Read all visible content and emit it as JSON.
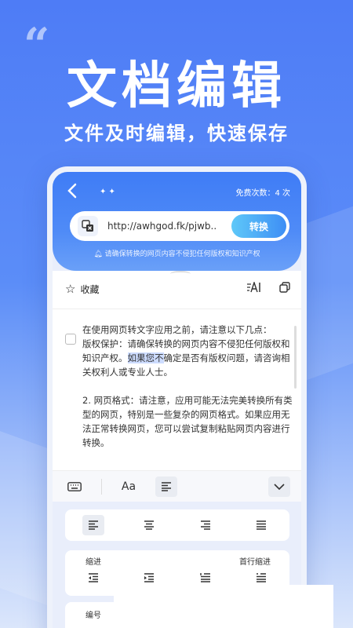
{
  "hero": {
    "quote": "“",
    "title": "文档编辑",
    "subtitle": "文件及时编辑，快速保存"
  },
  "app": {
    "free_count": "免费次数：4 次",
    "url_value": "http://awhgod.fk/pjwb..",
    "convert_label": "转换",
    "notice": "请确保转换的网页内容不侵犯任何版权和知识产权",
    "favorite_label": "收藏",
    "doc": {
      "intro": "在使用网页转文字应用之前，请注意以下几点：",
      "p1_a": "版权保护：请确保转换的网页内容不侵犯任何版权和知识产权。",
      "p1_sel": "如果您不",
      "p1_b": "确定是否有版权问题，请咨询相关权利人或专业人士。",
      "p2": "2. 网页格式：请注意，应用可能无法完美转换所有类型的网页，特别是一些复杂的网页格式。如果应用无法正常转换网页，您可以尝试复制粘贴网页内容进行转换。"
    },
    "toolbar": {
      "font_label": "Aa"
    },
    "indent_label": "缩进",
    "first_line_indent_label": "首行缩进",
    "list_label": "编号"
  },
  "colors": {
    "accent": "#3e8ef5",
    "bg_top": "#4e7cf6"
  }
}
